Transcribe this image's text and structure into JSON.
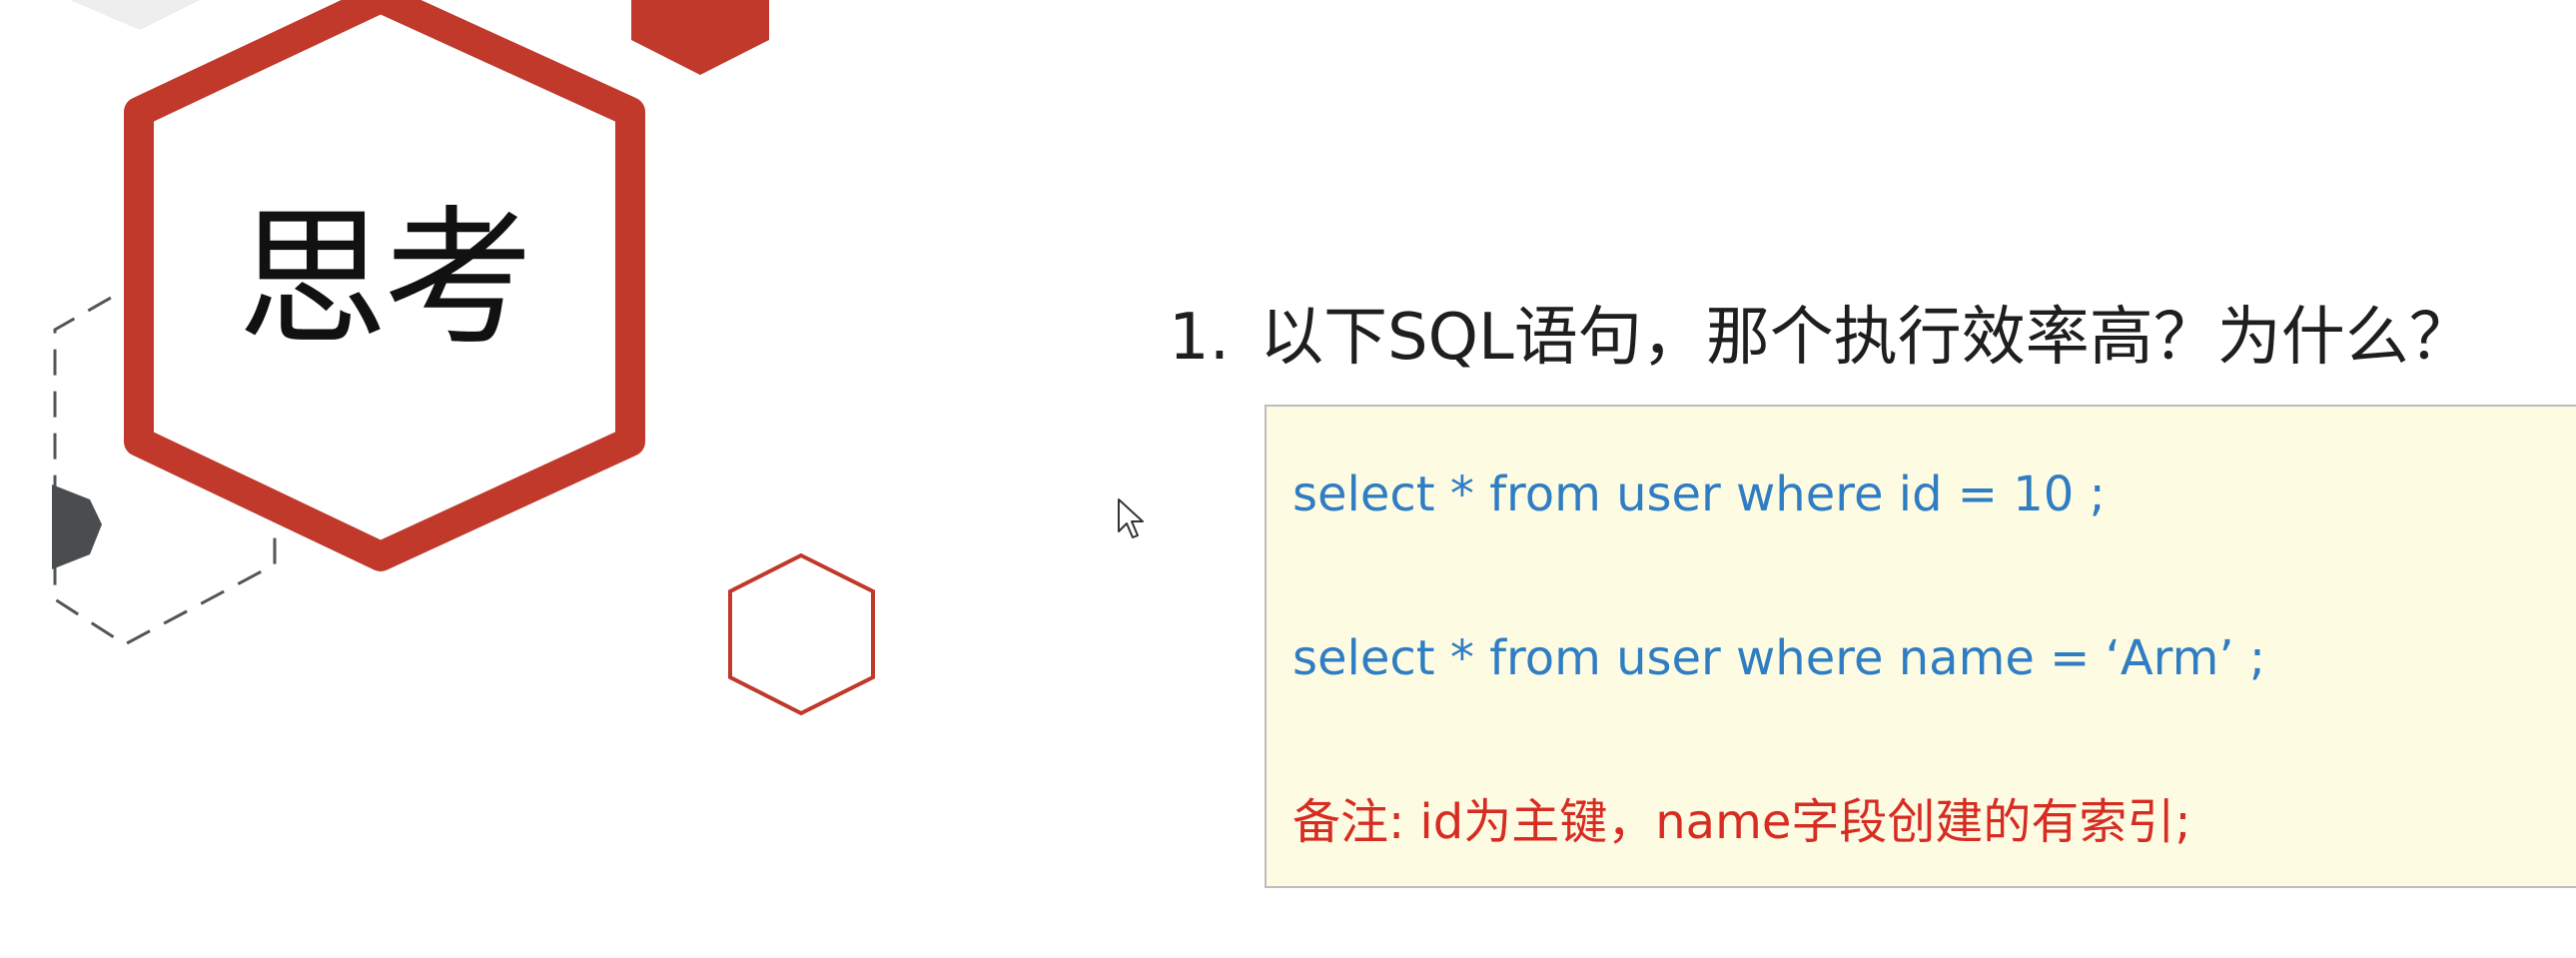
{
  "slide": {
    "title": "思考",
    "question_number": "1.",
    "question_text": "以下SQL语句，那个执行效率高？为什么？",
    "sql_statements": [
      "select * from user where id = 10 ;",
      "select * from user where name = ‘Arm’ ;"
    ],
    "note": "备注: id为主键，name字段创建的有索引;"
  },
  "colors": {
    "accent_red": "#c0392b",
    "sql_blue": "#2f7dc2",
    "note_red": "#d62c22",
    "box_background": "#fefbe3",
    "dark_gray": "#4a4d50"
  },
  "icons": [
    "hexagon-red-outline",
    "hexagon-dashed",
    "hexagon-small-outline",
    "mouse-cursor-icon"
  ]
}
